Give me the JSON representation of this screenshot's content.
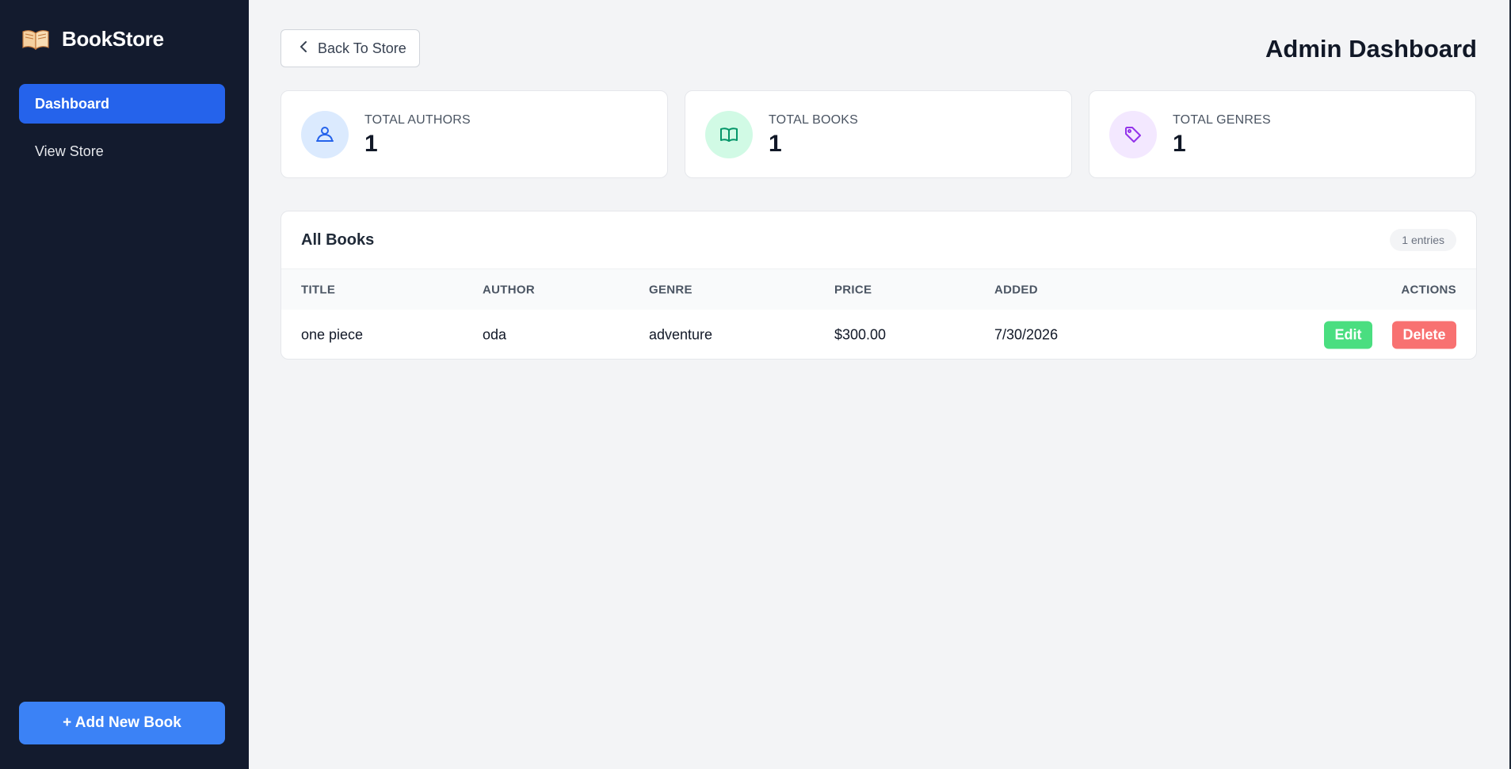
{
  "brand": {
    "name": "BookStore",
    "icon": "open-book-icon"
  },
  "sidebar": {
    "items": [
      {
        "label": "Dashboard",
        "active": true
      },
      {
        "label": "View Store",
        "active": false
      }
    ],
    "add_button": "+ Add New Book"
  },
  "header": {
    "back_button": "Back To Store",
    "title": "Admin Dashboard"
  },
  "stats": [
    {
      "label": "TOTAL AUTHORS",
      "value": "1",
      "icon": "users-icon",
      "icon_color": "#2563eb",
      "icon_bg": "#dbeafe"
    },
    {
      "label": "TOTAL BOOKS",
      "value": "1",
      "icon": "book-icon",
      "icon_color": "#059669",
      "icon_bg": "#d1fae5"
    },
    {
      "label": "TOTAL GENRES",
      "value": "1",
      "icon": "tag-icon",
      "icon_color": "#9333ea",
      "icon_bg": "#f3e8ff"
    }
  ],
  "books_table": {
    "title": "All Books",
    "entries": "1 entries",
    "columns": [
      "TITLE",
      "AUTHOR",
      "GENRE",
      "PRICE",
      "ADDED",
      "ACTIONS"
    ],
    "rows": [
      {
        "title": "one piece",
        "author": "oda",
        "genre": "adventure",
        "price": "$300.00",
        "added": "7/30/2026",
        "edit": "Edit",
        "delete": "Delete"
      }
    ]
  },
  "colors": {
    "sidebar_bg": "#131b2e",
    "accent": "#2563eb",
    "edit": "#4ade80",
    "delete": "#f87171"
  }
}
